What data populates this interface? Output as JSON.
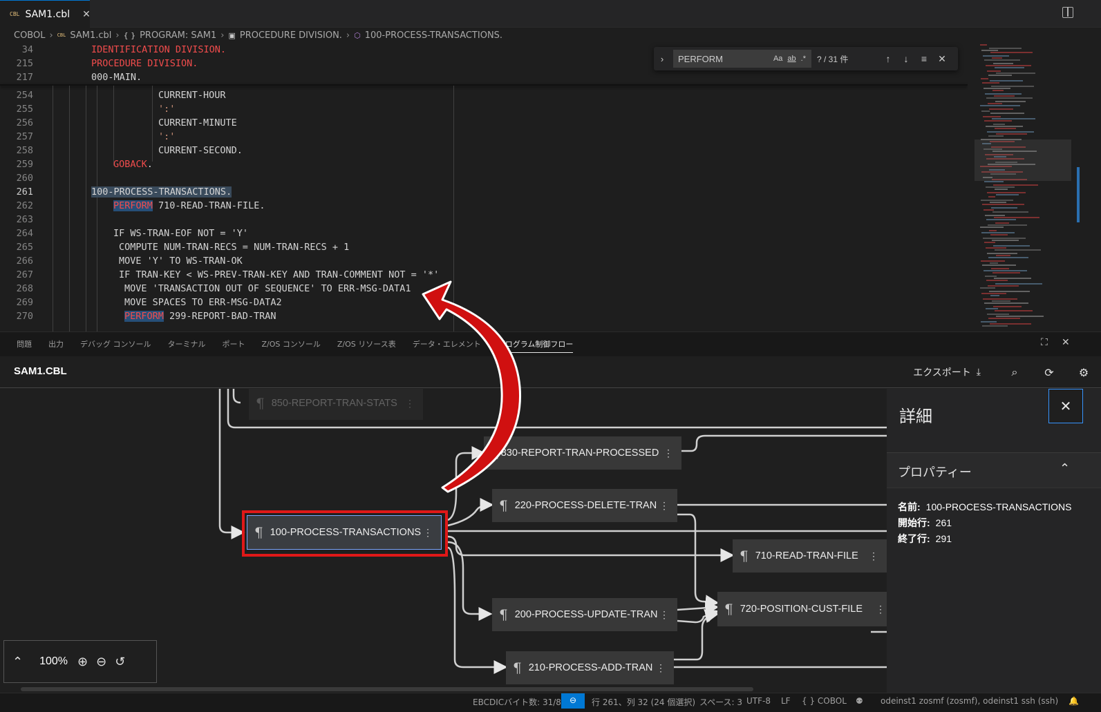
{
  "tab": {
    "badge": "CBL",
    "filename": "SAM1.cbl"
  },
  "breadcrumb": {
    "items": [
      "COBOL",
      "SAM1.cbl",
      "PROGRAM: SAM1",
      "PROCEDURE DIVISION.",
      "100-PROCESS-TRANSACTIONS."
    ]
  },
  "editor": {
    "sticky": [
      {
        "ln": "34",
        "text": "IDENTIFICATION DIVISION."
      },
      {
        "ln": "215",
        "text": "PROCEDURE DIVISION."
      },
      {
        "ln": "217",
        "text": "000-MAIN."
      }
    ],
    "lines": [
      {
        "ln": "254",
        "text": "CURRENT-HOUR"
      },
      {
        "ln": "255",
        "text": "':'"
      },
      {
        "ln": "256",
        "text": "CURRENT-MINUTE"
      },
      {
        "ln": "257",
        "text": "':'"
      },
      {
        "ln": "258",
        "text": "CURRENT-SECOND."
      },
      {
        "ln": "259",
        "kw": "GOBACK",
        "rest": "."
      },
      {
        "ln": "260",
        "text": ""
      },
      {
        "ln": "261",
        "text": "100-PROCESS-TRANSACTIONS."
      },
      {
        "ln": "262",
        "kw": "PERFORM",
        "rest": " 710-READ-TRAN-FILE."
      },
      {
        "ln": "263",
        "text": ""
      },
      {
        "ln": "264",
        "text": "IF WS-TRAN-EOF NOT = 'Y'"
      },
      {
        "ln": "265",
        "text": "COMPUTE NUM-TRAN-RECS = NUM-TRAN-RECS + 1"
      },
      {
        "ln": "266",
        "text": "MOVE 'Y' TO WS-TRAN-OK"
      },
      {
        "ln": "267",
        "text": "IF TRAN-KEY < WS-PREV-TRAN-KEY AND TRAN-COMMENT NOT = '*'"
      },
      {
        "ln": "268",
        "text": "MOVE 'TRANSACTION OUT OF SEQUENCE' TO ERR-MSG-DATA1"
      },
      {
        "ln": "269",
        "text": "MOVE SPACES TO ERR-MSG-DATA2"
      },
      {
        "ln": "270",
        "kw": "PERFORM",
        "rest": " 299-REPORT-BAD-TRAN"
      }
    ]
  },
  "find": {
    "query": "PERFORM",
    "opt_case": "Aa",
    "opt_word": "ab",
    "opt_regex": ".*",
    "count": "? / 31 件"
  },
  "panel": {
    "tabs": [
      "問題",
      "出力",
      "デバッグ コンソール",
      "ターミナル",
      "ポート",
      "Z/OS コンソール",
      "Z/OS リソース表",
      "データ・エレメント",
      "プログラム制御フロー"
    ],
    "active": "プログラム制御フロー"
  },
  "flow": {
    "title": "SAM1.CBL",
    "export_label": "エクスポート",
    "nodes": {
      "n850": "850-REPORT-TRAN-STATS",
      "n830": "830-REPORT-TRAN-PROCESSED",
      "n220": "220-PROCESS-DELETE-TRAN",
      "n100": "100-PROCESS-TRANSACTIONS",
      "n710": "710-READ-TRAN-FILE",
      "n200": "200-PROCESS-UPDATE-TRAN",
      "n720": "720-POSITION-CUST-FILE",
      "n210": "210-PROCESS-ADD-TRAN"
    },
    "zoom": "100%"
  },
  "details": {
    "title": "詳細",
    "section": "プロパティー",
    "name_label": "名前:",
    "name_value": "100-PROCESS-TRANSACTIONS",
    "start_label": "開始行:",
    "start_value": "261",
    "end_label": "終了行:",
    "end_value": "291"
  },
  "status": {
    "ebcdic": "EBCDICバイト数: 31/80",
    "position": "行 261、列 32 (24 個選択)",
    "spaces": "スペース: 3",
    "encoding": "UTF-8",
    "eol": "LF",
    "language": "{ } COBOL",
    "connection": "odeinst1 zosmf (zosmf), odeinst1 ssh (ssh)"
  },
  "colors": {
    "accent": "#0078d4",
    "keyword": "#f14c4c",
    "annotation": "#e01818"
  }
}
